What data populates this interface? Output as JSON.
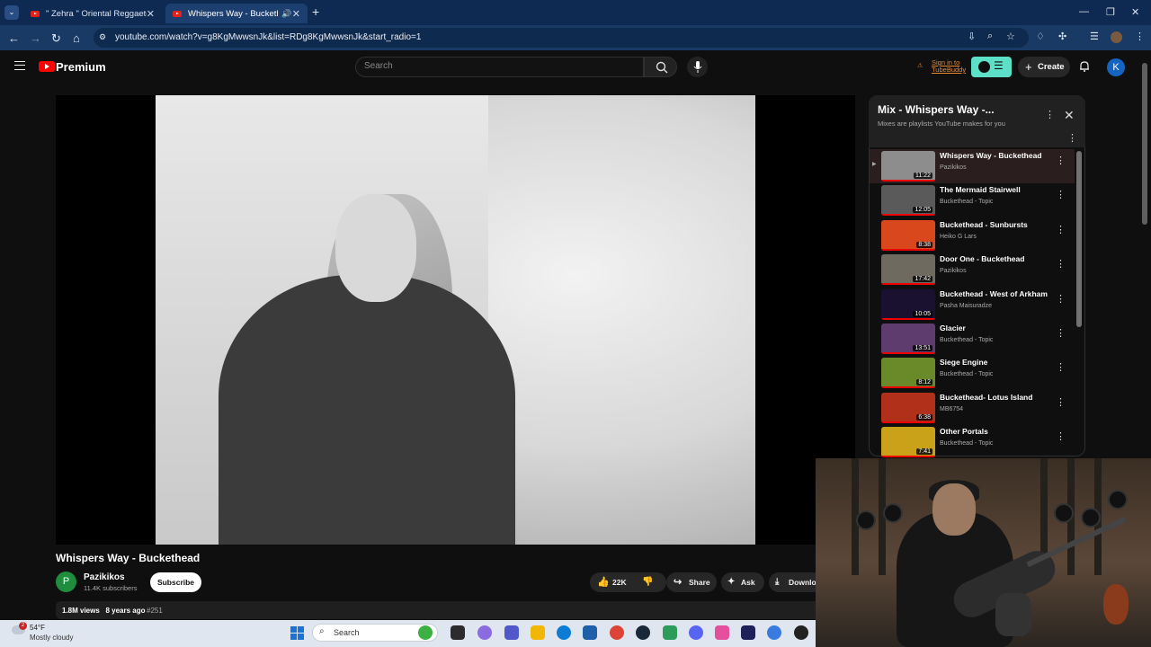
{
  "browser": {
    "tabs": [
      {
        "title": "\" Zehra \" Oriental Reggaeton Ty"
      },
      {
        "title": "Whispers Way - Buckethead"
      }
    ],
    "url": "youtube.com/watch?v=g8KgMwwsnJk&list=RDg8KgMwwsnJk&start_radio=1"
  },
  "header": {
    "logo": "Premium",
    "search_placeholder": "Search",
    "signin_line1": "Sign in to",
    "signin_line2": "TubeBuddy",
    "create_label": "Create",
    "avatar_letter": "K"
  },
  "video": {
    "title": "Whispers Way - Buckethead",
    "channel": "Pazikikos",
    "channel_initial": "P",
    "subscribers": "11.4K subscribers",
    "subscribe_label": "Subscribe",
    "likes": "22K",
    "share_label": "Share",
    "ask_label": "Ask",
    "download_label": "Download",
    "views": "1.8M views",
    "age": "8 years ago",
    "hashtag": "#251"
  },
  "playlist": {
    "title": "Mix - Whispers Way -...",
    "subtitle": "Mixes are playlists YouTube makes for you",
    "items": [
      {
        "title": "Whispers Way - Buckethead",
        "channel": "Pazikikos",
        "duration": "11:22",
        "active": true
      },
      {
        "title": "The Mermaid Stairwell",
        "channel": "Buckethead - Topic",
        "duration": "12:05"
      },
      {
        "title": "Buckethead - Sunbursts",
        "channel": "Heiko G Lars",
        "duration": "8:38"
      },
      {
        "title": "Door One - Buckethead",
        "channel": "Pazikikos",
        "duration": "17:42"
      },
      {
        "title": "Buckethead - West of Arkham",
        "channel": "Pasha Maisuradze",
        "duration": "10:05"
      },
      {
        "title": "Glacier",
        "channel": "Buckethead - Topic",
        "duration": "13:51"
      },
      {
        "title": "Siege Engine",
        "channel": "Buckethead - Topic",
        "duration": "8:12"
      },
      {
        "title": "Buckethead- Lotus Island",
        "channel": "MB6754",
        "duration": "6:38"
      },
      {
        "title": "Other Portals",
        "channel": "Buckethead - Topic",
        "duration": "7:41"
      }
    ]
  },
  "taskbar": {
    "temperature": "54°F",
    "condition": "Mostly cloudy",
    "weather_badge": "2",
    "search_label": "Search"
  }
}
